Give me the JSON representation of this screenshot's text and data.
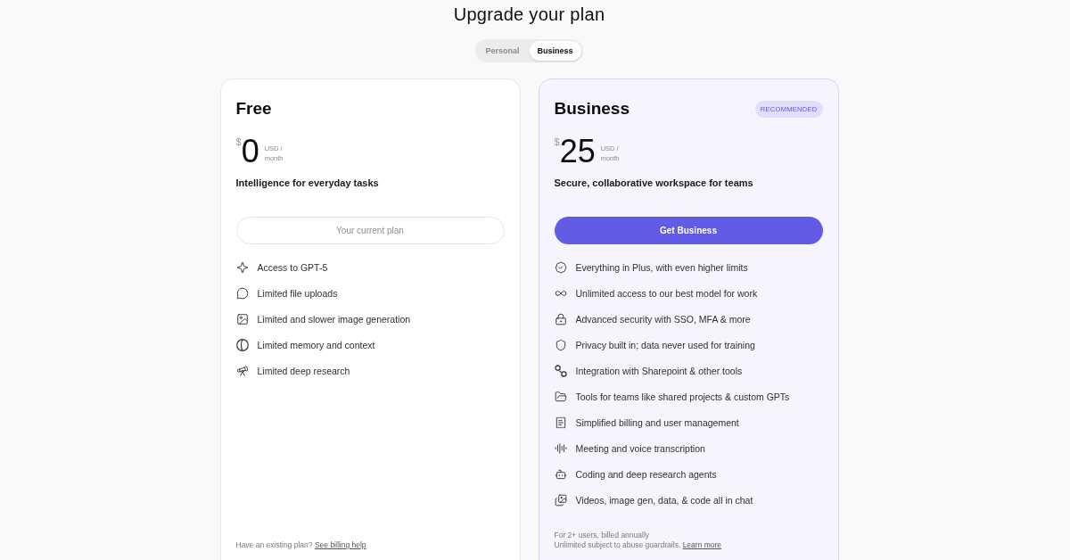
{
  "title": "Upgrade your plan",
  "tabs": [
    {
      "label": "Personal",
      "selected": false
    },
    {
      "label": "Business",
      "selected": true
    }
  ],
  "plans": [
    {
      "name": "Free",
      "highlighted": false,
      "price": {
        "currency": "$",
        "amount": "0",
        "unit": "USD /",
        "period": "month"
      },
      "tagline": "Intelligence for everyday tasks",
      "button": {
        "label": "Your current plan",
        "disabled": true
      },
      "features": [
        "Access to GPT-5",
        "Limited file uploads",
        "Limited and slower image generation",
        "Limited memory and context",
        "Limited deep research"
      ],
      "footer": [
        {
          "text": "Have an existing plan?",
          "link": "See billing help"
        }
      ]
    },
    {
      "name": "Business",
      "badge": "RECOMMENDED",
      "highlighted": true,
      "price": {
        "currency": "$",
        "amount": "25",
        "unit": "USD /",
        "period": "month"
      },
      "tagline": "Secure, collaborative workspace for teams",
      "button": {
        "label": "Get Business",
        "disabled": false
      },
      "features": [
        "Everything in Plus, with even higher limits",
        "Unlimited access to our best model for work",
        "Advanced security with SSO, MFA & more",
        "Privacy built in; data never used for training",
        "Integration with Sharepoint & other tools",
        "Tools for teams like shared projects & custom GPTs",
        "Simplified billing and user management",
        "Meeting and voice transcription",
        "Coding and deep research agents",
        "Videos, image gen, data, & code all in chat"
      ],
      "footer": [
        {
          "text": "For 2+ users, billed annually"
        },
        {
          "text": "Unlimited subject to abuse guardrails.",
          "link": "Learn more"
        }
      ]
    }
  ]
}
